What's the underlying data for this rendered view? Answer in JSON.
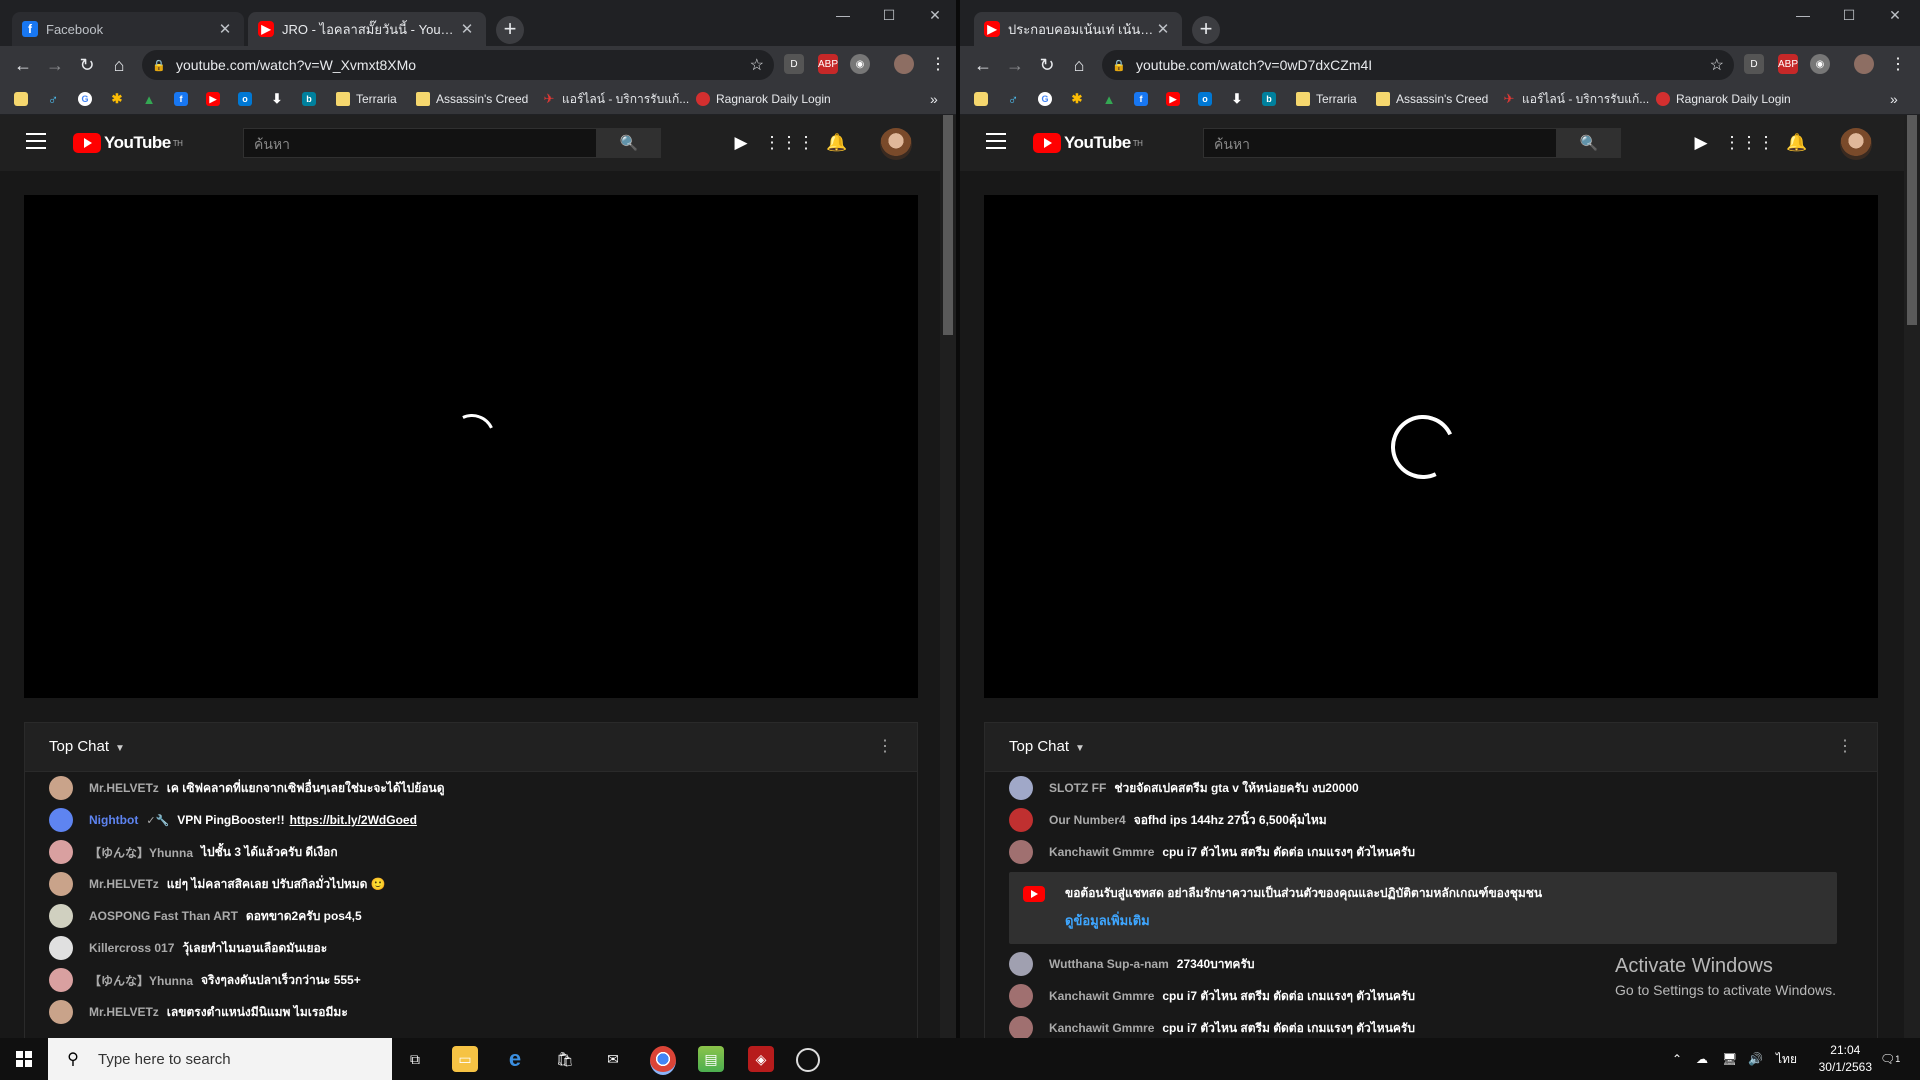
{
  "left": {
    "tabs": [
      {
        "title": "Facebook",
        "favicon": "facebook-favicon",
        "active": false
      },
      {
        "title": "JRO - ไอคลาสมั๊ยวันนี้ - YouTube",
        "favicon": "youtube-favicon",
        "active": true
      }
    ],
    "url": "youtube.com/watch?v=W_Xvmxt8XMo",
    "chat": [
      {
        "author": "Mr.HELVETz",
        "text": "เค เซิฟคลาดที่แยกจากเซิฟอื่นๆเลยใช่มะจะได้ไปย้อนดู",
        "color": "#c9a38a"
      },
      {
        "author": "Nightbot",
        "text": "VPN PingBooster!!",
        "link": "https://bit.ly/2WdGoed",
        "mod": true,
        "color": "#5e84f1"
      },
      {
        "author": "【ゆんな】Yhunna",
        "text": "ไปชั้น 3 ได้แล้วครับ ดีเงือก",
        "color": "#d9a0a0"
      },
      {
        "author": "Mr.HELVETz",
        "text": "แย่ๆ ไม่คลาสสิคเลย ปรับสกิลมั่วไปหมด 🙂",
        "color": "#c9a38a"
      },
      {
        "author": "AOSPONG Fast Than ART",
        "text": "ดอทขาด2ครับ pos4,5",
        "color": "#d0d0c0"
      },
      {
        "author": "Killercross 017",
        "text": "วุ้เลยทำไมนอนเลือดมันเยอะ",
        "color": "#e0e0e0"
      },
      {
        "author": "【ゆんな】Yhunna",
        "text": "จริงๆลงดันปลาเร็วกว่านะ 555+",
        "color": "#d9a0a0"
      },
      {
        "author": "Mr.HELVETz",
        "text": "เลขตรงตำแหน่งมีนิแมพ ไมเรอมีมะ",
        "color": "#c9a38a"
      }
    ]
  },
  "right": {
    "tabs": [
      {
        "title": "ประกอบคอมเน้นเท่ เน้นแรง ได้ทั้งสวยทั้งแรง",
        "favicon": "youtube-favicon",
        "active": true
      }
    ],
    "url": "youtube.com/watch?v=0wD7dxCZm4I",
    "chat_top": [
      {
        "author": "SLOTZ FF",
        "text": "ช่วยจัดสเปคสตรีม gta v ให้หน่อยครับ งบ20000",
        "color": "#a0a8c8"
      },
      {
        "author": "Our Number4",
        "text": "จอfhd ips 144hz 27นิ้ว 6,500คุ้มไหม",
        "color": "#c03030"
      },
      {
        "author": "Kanchawit Gmmre",
        "text": "cpu i7 ตัวไหน สตรีม ตัดต่อ เกมแรงๆ ตัวไหนครับ",
        "color": "#a07070"
      }
    ],
    "notice_text": "ขอต้อนรับสู่แชทสด อย่าลืมรักษาความเป็นส่วนตัวของคุณและปฏิบัติตามหลักเกณฑ์ของชุมชน",
    "notice_link": "ดูข้อมูลเพิ่มเติม",
    "chat_bottom": [
      {
        "author": "Wutthana Sup-a-nam",
        "text": "27340บาทครับ",
        "color": "#a0a0b0"
      },
      {
        "author": "Kanchawit Gmmre",
        "text": "cpu i7 ตัวไหน สตรีม ตัดต่อ เกมแรงๆ ตัวไหนครับ",
        "color": "#a07070"
      },
      {
        "author": "Kanchawit Gmmre",
        "text": "cpu i7 ตัวไหน สตรีม ตัดต่อ เกมแรงๆ ตัวไหนครับ",
        "color": "#a07070"
      }
    ]
  },
  "bookmarks": [
    "Terraria",
    "Assassin's Creed",
    "แอร์ไลน์ - บริการรับแก้...",
    "Ragnarok Daily Login"
  ],
  "youtube": {
    "logo_text": "YouTube",
    "region": "TH",
    "search_placeholder": "ค้นหา",
    "chat_title": "Top Chat"
  },
  "watermark": {
    "line1": "Activate Windows",
    "line2": "Go to Settings to activate Windows."
  },
  "taskbar": {
    "search_placeholder": "Type here to search",
    "language": "ไทย",
    "time": "21:04",
    "date": "30/1/2563",
    "notification_count": "1"
  },
  "colors": {
    "youtube_red": "#ff0000",
    "link_blue": "#3ea6ff",
    "mod_blue": "#5e84f1",
    "chrome_dark": "#35363a"
  }
}
